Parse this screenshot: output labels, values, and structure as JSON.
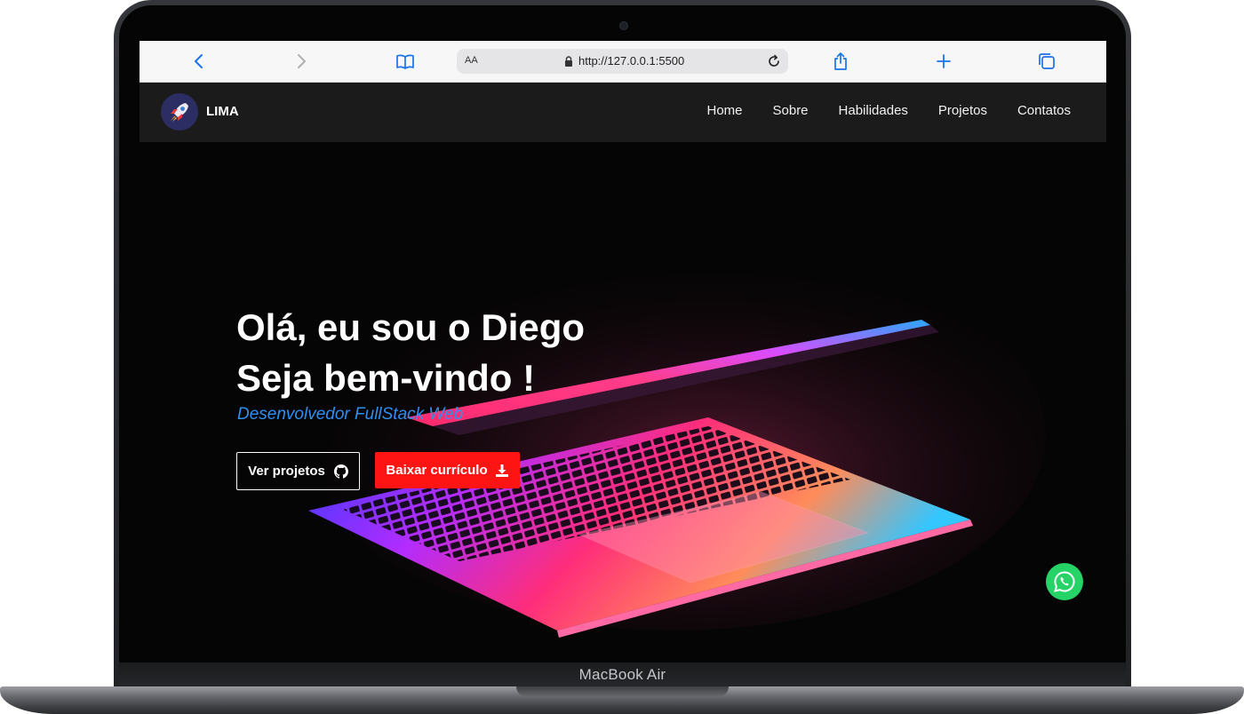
{
  "device": {
    "label": "MacBook Air"
  },
  "browser": {
    "url": "http://127.0.0.1:5500",
    "reader_label": "AA"
  },
  "site": {
    "brand": "LIMA",
    "nav": [
      "Home",
      "Sobre",
      "Habilidades",
      "Projetos",
      "Contatos"
    ]
  },
  "hero": {
    "line1": "Olá, eu sou o Diego",
    "line2": "Seja bem-vindo !",
    "subtitle": "Desenvolvedor FullStack Web",
    "btn_projects": "Ver projetos",
    "btn_resume": "Baixar currículo"
  },
  "colors": {
    "accent_blue": "#2f8ff0",
    "button_red": "#ff1414",
    "whatsapp_green": "#25d366",
    "nav_bg": "#1b1b1b",
    "browser_icon_blue": "#1a73e8"
  },
  "icons": [
    "back-icon",
    "forward-icon",
    "bookmarks-icon",
    "lock-icon",
    "reload-icon",
    "share-icon",
    "new-tab-icon",
    "tabs-icon",
    "rocket-icon",
    "github-icon",
    "download-icon",
    "whatsapp-icon"
  ]
}
